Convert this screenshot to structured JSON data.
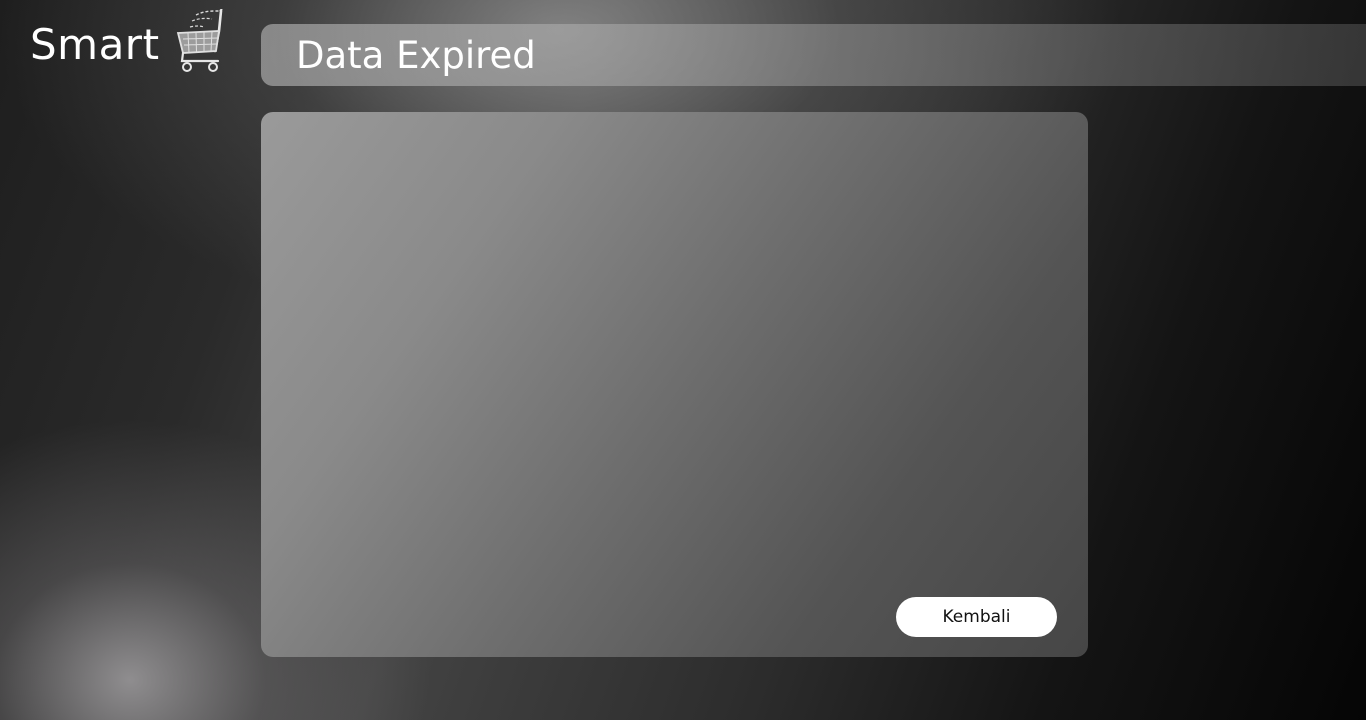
{
  "app": {
    "logo_text": "Smart",
    "logo_icon": "shopping-cart-icon"
  },
  "header": {
    "title": "Data Expired"
  },
  "panel": {
    "back_button_label": "Kembali"
  },
  "colors": {
    "text": "#ffffff",
    "button_bg": "#ffffff",
    "button_text": "#111111"
  }
}
